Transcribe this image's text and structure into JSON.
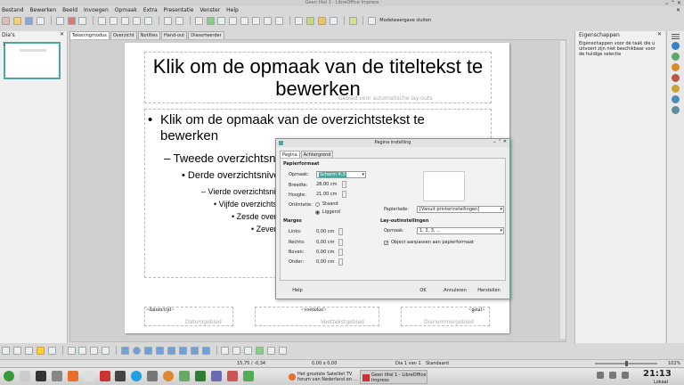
{
  "window": {
    "title": "Geen titel 1 - LibreOffice Impress"
  },
  "menubar": {
    "items": [
      "Bestand",
      "Bewerken",
      "Beeld",
      "Invoegen",
      "Opmaak",
      "Extra",
      "Presentatie",
      "Venster",
      "Help"
    ]
  },
  "toolbar": {
    "close_master_label": "Modelweergave sluiten"
  },
  "slides_pane": {
    "title": "Dia's",
    "thumb_number": "1"
  },
  "view_tabs": [
    "Tekeningmodus",
    "Overzicht",
    "Notities",
    "Hand-out",
    "Diasorteerder"
  ],
  "slide": {
    "title_text": "Klik om de opmaak van de titeltekst te bewerken",
    "autolayout_text": "Gebied voor automatische lay-outs",
    "outline": [
      "Klik om de opmaak van de overzichtstekst te bewerken",
      "Tweede overzichtsniveau",
      "Derde overzichtsniveau",
      "Vierde overzichtsniveau",
      "Vijfde overzichtsniveau",
      "Zesde overzichtsniveau",
      "Zevende overzichtsniveau"
    ],
    "footer": {
      "date_field": "<datum/tijd>",
      "date_area": "Datumgebied",
      "footer_field": "<voettekst>",
      "footer_area": "Voettekstgebied",
      "number_field": "<getal>",
      "number_area": "Dianummergebied"
    }
  },
  "sidebar": {
    "title": "Eigenschappen",
    "body": "Eigenschappen voor de taak die u uitvoert zijn niet beschikbaar voor de huidige selectie"
  },
  "dialog": {
    "title": "Pagina instelling",
    "tabs": [
      "Pagina",
      "Achtergrond"
    ],
    "paper_header": "Papierformaat",
    "format_label": "Opmaak:",
    "format_value": "Scherm 4:3",
    "width_label": "Breedte:",
    "width_value": "28,00 cm",
    "height_label": "Hoogte:",
    "height_value": "21,00 cm",
    "orientation_label": "Oriëntatie:",
    "portrait": "Staand",
    "landscape": "Liggend",
    "tray_label": "Papierlade:",
    "tray_value": "[Vanuit printerinstellingen]",
    "margins_header": "Marges",
    "left_label": "Links:",
    "left_value": "0,00 cm",
    "right_label": "Rechts:",
    "right_value": "0,00 cm",
    "top_label": "Boven:",
    "top_value": "0,00 cm",
    "bottom_label": "Onder:",
    "bottom_value": "0,00 cm",
    "layout_header": "Lay-outinstellingen",
    "layout_format_label": "Opmaak:",
    "layout_format_value": "1, 2, 3, ...",
    "fit_label": "Object aanpassen aan papierformaat",
    "help": "Help",
    "ok": "OK",
    "cancel": "Annuleren",
    "reset": "Herstellen"
  },
  "statusbar": {
    "position": "15,75 / -0,34",
    "size": "0,00 x 0,00",
    "slide": "Dia 1 van 1",
    "style": "Standaard",
    "zoom": "102%"
  },
  "taskbar": {
    "task1": "Het grootste Satelliet TV forum van Nederland en ...",
    "task2": "Geen titel 1 - LibreOffice Impress",
    "time": "21:13",
    "tz": "Lokaal"
  },
  "colors": {
    "accent": "#4aa8a0",
    "dialog_border": "#6aa39b"
  }
}
